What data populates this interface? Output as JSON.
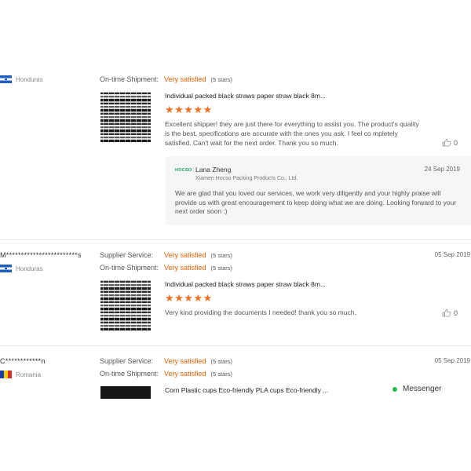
{
  "reviews": [
    {
      "country": "Honduras",
      "ratings": [
        {
          "label": "On-time Shipment:",
          "value": "Very satisfied",
          "stars": "(5 stars)"
        }
      ],
      "product_title": "Individual packed black straws paper straw black 8m...",
      "stars": "★★★★★",
      "text": "Excellent shipper! they are just there for everything to assist you. The product's quality is the best, specifications are accurate with the ones you ask. I feel co mpletely satisfied. Can't wait for the next order. Thank you so much.",
      "likes": "0",
      "reply": {
        "logo": "HOCSO",
        "author": "Lana Zheng",
        "company": "Xiamen Hocso Packing Products Co., Ltd.",
        "date": "24 Sep 2019",
        "text": "We are glad that you loved our services, we work very diligently and your highly praise will provide us with great encouragement to keep doing what we are doing. Looking forward to your next order soon :)"
      }
    },
    {
      "buyer": "M************************s",
      "country": "Honduras",
      "date": "05 Sep 2019",
      "ratings": [
        {
          "label": "Supplier Service:",
          "value": "Very satisfied",
          "stars": "(5 stars)"
        },
        {
          "label": "On-time Shipment:",
          "value": "Very satisfied",
          "stars": "(5 stars)"
        }
      ],
      "product_title": "Individual packed black straws paper straw black 8m...",
      "stars": "★★★★★",
      "text": "Very kind providing the documents I needed! thank you so much.",
      "likes": "0"
    },
    {
      "buyer": "C************n",
      "country": "Romania",
      "date": "05 Sep 2019",
      "ratings": [
        {
          "label": "Supplier Service:",
          "value": "Very satisfied",
          "stars": "(5 stars)"
        },
        {
          "label": "On-time Shipment:",
          "value": "Very satisfied",
          "stars": "(5 stars)"
        }
      ],
      "product_title": "Corn Plastic cups Eco-friendly PLA cups Eco-friendly ..."
    }
  ],
  "messenger": {
    "label": "Messenger",
    "status_color": "#1fbf4a"
  },
  "colors": {
    "accent": "#e8620a",
    "stars": "#f36f21",
    "reply_bg": "#f5f6f8"
  },
  "icons": {
    "like": "thumbs-up-icon",
    "flag_honduras": "honduras-flag-icon",
    "flag_romania": "romania-flag-icon"
  }
}
